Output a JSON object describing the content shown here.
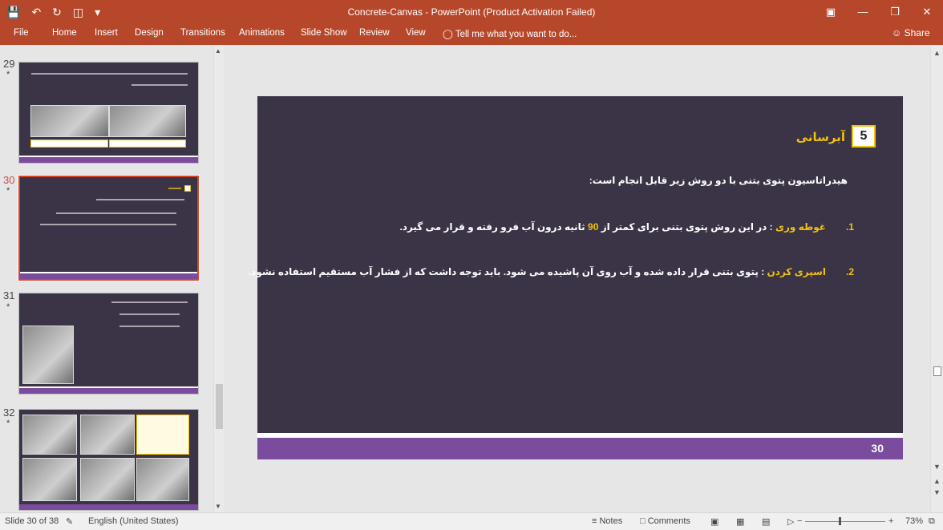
{
  "titlebar": {
    "title": "Concrete-Canvas - PowerPoint (Product Activation Failed)",
    "qat": [
      "save-icon",
      "undo-icon",
      "redo-icon",
      "present-icon",
      "customize-icon"
    ],
    "window_buttons": [
      "ribbon-display-icon",
      "minimize-icon",
      "restore-icon",
      "close-icon"
    ]
  },
  "ribbon": {
    "tabs": [
      "File",
      "Home",
      "Insert",
      "Design",
      "Transitions",
      "Animations",
      "Slide Show",
      "Review",
      "View"
    ],
    "tell_me": "Tell me what you want to do...",
    "share": "Share"
  },
  "thumbnails": [
    {
      "number": "29",
      "star": "*"
    },
    {
      "number": "30",
      "star": "*",
      "active": true
    },
    {
      "number": "31",
      "star": "*"
    },
    {
      "number": "32",
      "star": "*"
    }
  ],
  "slide": {
    "section_number": "5",
    "heading": "آبرسانی",
    "intro": "هیدراتاسیون پتوی بتنی با دو روش زیر قابل انجام است:",
    "items": [
      {
        "num": "1.",
        "keyword": "غوطه وری",
        "text_before": " : در این روش پتوی بتنی برای کمتر از ",
        "highlight": "90",
        "text_after": " ثانیه درون آب فرو رفته و قرار می گیرد."
      },
      {
        "num": "2.",
        "keyword": "اسپری کردن",
        "text_before": " : پتوی بتنی قرار داده شده و آب روی آن پاشیده می شود. باید توجه داشت که از فشار آب مستقیم استفاده نشود.",
        "highlight": "",
        "text_after": ""
      }
    ],
    "page_number": "30"
  },
  "status": {
    "slide_info": "Slide 30 of 38",
    "language": "English (United States)",
    "notes": "Notes",
    "comments": "Comments",
    "zoom": "73%"
  },
  "colors": {
    "ribbon": "#b7472a",
    "slide_bg": "#3a3446",
    "accent_yellow": "#f2c011",
    "accent_purple": "#7b4b9e"
  }
}
